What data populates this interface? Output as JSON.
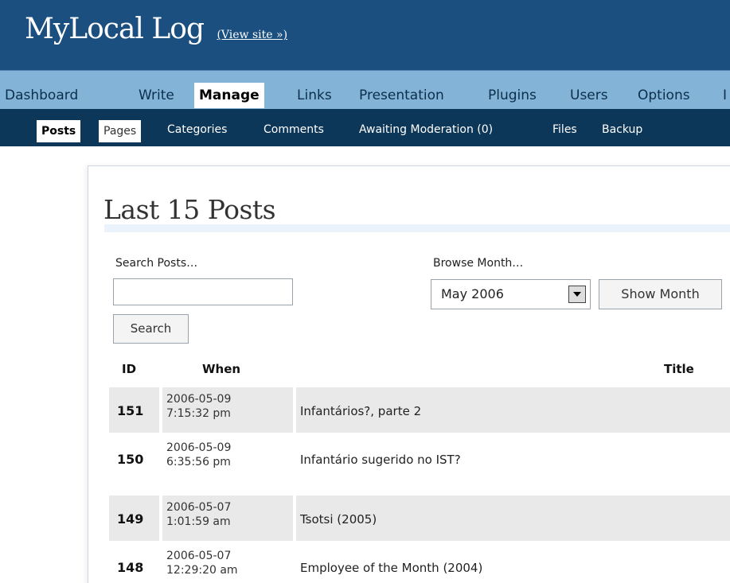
{
  "header": {
    "site_title": "MyLocal Log",
    "view_site": "(View site »)"
  },
  "menu": {
    "items": [
      {
        "label": "Dashboard"
      },
      {
        "label": "Write"
      },
      {
        "label": "Manage",
        "active": true
      },
      {
        "label": "Links"
      },
      {
        "label": "Presentation"
      },
      {
        "label": "Plugins"
      },
      {
        "label": "Users"
      },
      {
        "label": "Options"
      },
      {
        "label": "I"
      }
    ]
  },
  "submenu": {
    "items": [
      {
        "label": "Posts",
        "active": true
      },
      {
        "label": "Pages"
      },
      {
        "label": "Categories"
      },
      {
        "label": "Comments"
      },
      {
        "label": "Awaiting Moderation (0)"
      },
      {
        "label": "Files"
      },
      {
        "label": "Backup"
      }
    ]
  },
  "main": {
    "heading": "Last 15 Posts",
    "search": {
      "label": "Search Posts…",
      "value": "",
      "button": "Search"
    },
    "browse": {
      "label": "Browse Month…",
      "selected": "May 2006",
      "button": "Show Month"
    },
    "table": {
      "columns": {
        "id": "ID",
        "when": "When",
        "title": "Title"
      },
      "rows": [
        {
          "id": "151",
          "date": "2006-05-09",
          "time": "7:15:32 pm",
          "title": "Infantários?, parte 2"
        },
        {
          "id": "150",
          "date": "2006-05-09",
          "time": "6:35:56 pm",
          "title": "Infantário sugerido no IST?"
        },
        {
          "id": "149",
          "date": "2006-05-07",
          "time": "1:01:59 am",
          "title": "Tsotsi (2005)"
        },
        {
          "id": "148",
          "date": "2006-05-07",
          "time": "12:29:20 am",
          "title": "Employee of the Month (2004)"
        }
      ]
    }
  },
  "colors": {
    "header_bg": "#1a4f80",
    "menu_bg": "#83b4d8",
    "submenu_bg": "#0d3759",
    "row_shade": "#e9e9e9"
  }
}
